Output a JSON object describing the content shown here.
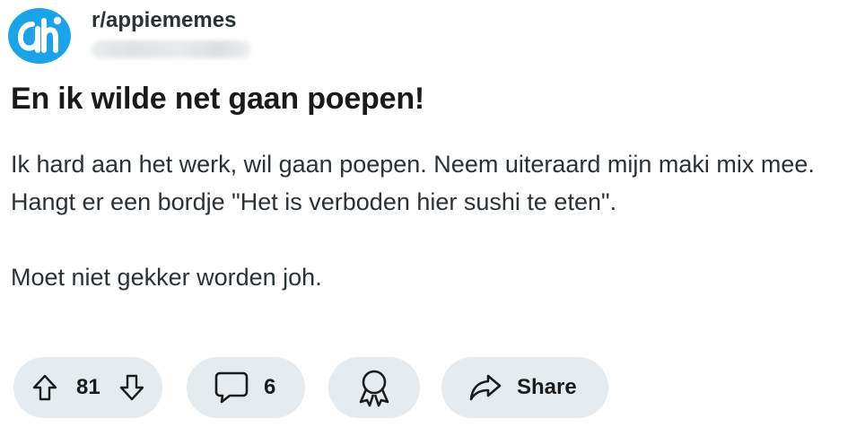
{
  "post": {
    "subreddit": "r/appiememes",
    "title": "En ik wilde net gaan poepen!",
    "body": [
      "Ik hard aan het werk, wil gaan poepen. Neem uiteraard mijn maki mix mee. Hangt er een bordje \"Het is verboden hier sushi te eten\".",
      "Moet niet gekker worden joh."
    ]
  },
  "actions": {
    "score": "81",
    "comments": "6",
    "share_label": "Share"
  },
  "icons": {
    "avatar": "albert-heijn-logo",
    "upvote": "arrow-up-icon",
    "downvote": "arrow-down-icon",
    "comment": "speech-bubble-icon",
    "award": "award-ribbon-icon",
    "share": "share-arrow-icon"
  },
  "colors": {
    "avatar_bg": "#1aa3e8",
    "pill_bg": "#e5ebee",
    "text": "#1c1c1c"
  }
}
